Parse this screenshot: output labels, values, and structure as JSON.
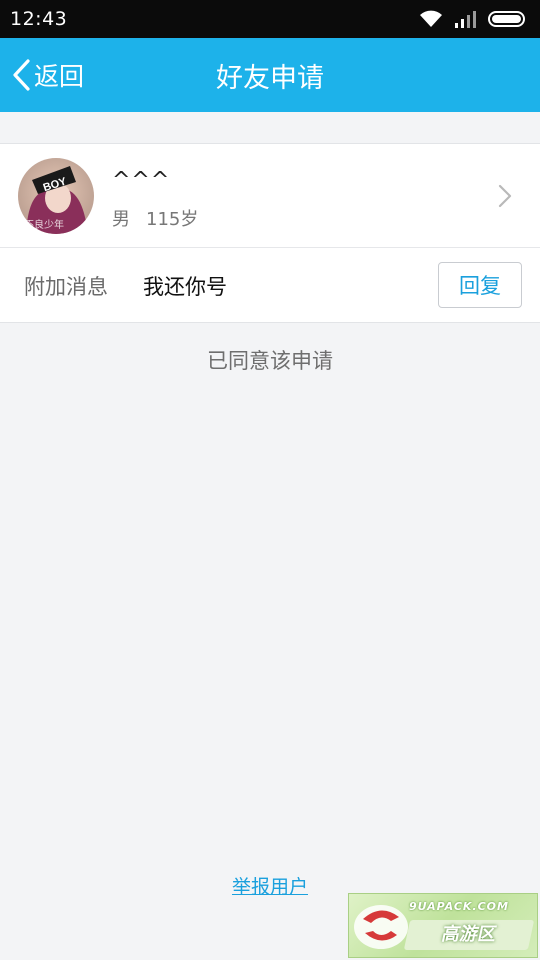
{
  "status_bar": {
    "time": "12:43",
    "icons": [
      "wifi-icon",
      "signal-icon",
      "battery-icon"
    ]
  },
  "title_bar": {
    "back_label": "返回",
    "title": "好友申请",
    "color": "#1db2ea"
  },
  "user": {
    "name": "^^^",
    "gender": "男",
    "age": "115岁",
    "avatar_text": "BOY",
    "avatar_caption": "不良少年"
  },
  "message": {
    "label": "附加消息",
    "text": "我还你号",
    "reply_label": "回复"
  },
  "status_text": "已同意该申请",
  "report_label": "举报用户",
  "watermark": {
    "top_text": "9UAPACK.COM",
    "bottom_text": "高游区"
  }
}
